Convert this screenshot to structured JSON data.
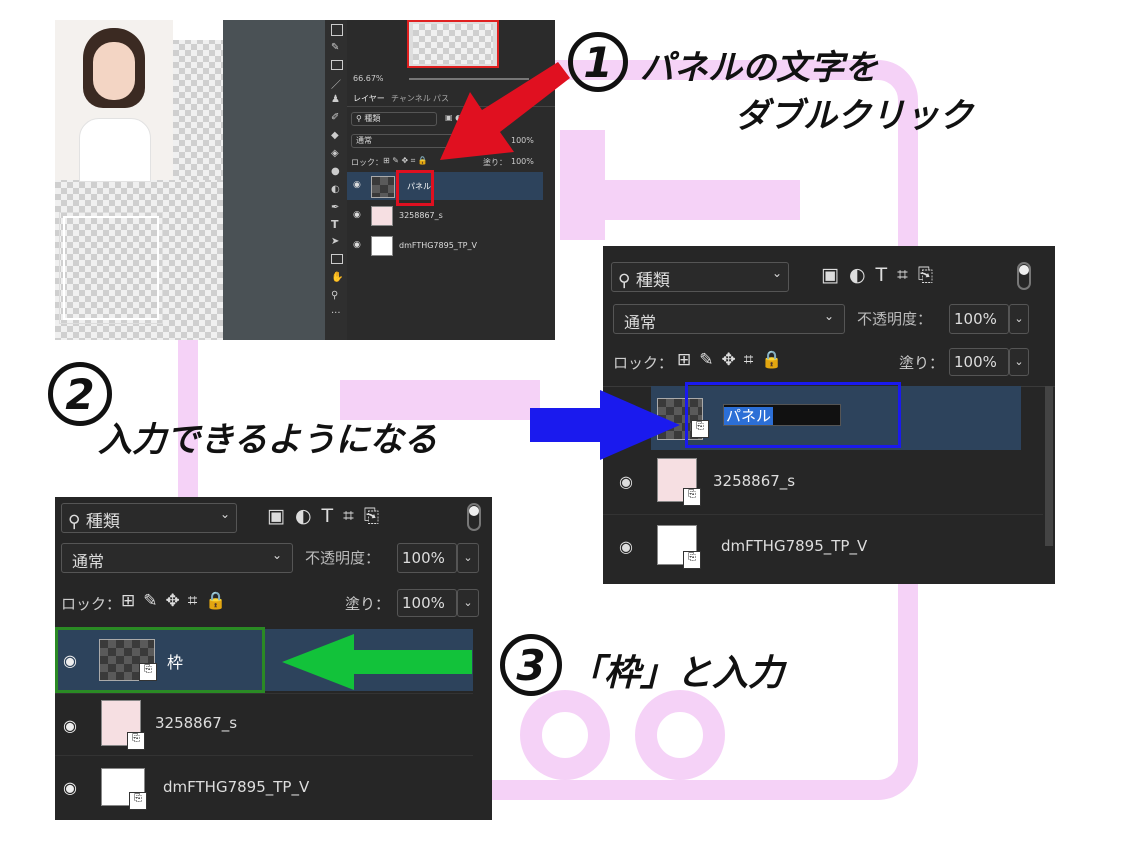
{
  "colors": {
    "accent_red": "#e01020",
    "accent_blue": "#1a1aee",
    "accent_green": "#12c23a",
    "pink_watermark": "#f5d2f7",
    "panel_bg": "#262626",
    "selected_row": "#2d435c"
  },
  "step1": {
    "number": "1",
    "line1": "パネルの文字を",
    "line2": "ダブルクリック"
  },
  "step2": {
    "number": "2",
    "text": "入力できるようになる"
  },
  "step3": {
    "number": "3",
    "text": "「枠」と入力"
  },
  "shot1": {
    "zoom": "66.67%",
    "tabs": [
      "レイヤー",
      "チャンネル",
      "パス"
    ],
    "kind_label": "種類",
    "blend_mode": "通常",
    "opacity_value": "100%",
    "lock_label": "ロック：",
    "fill_label": "塗り：",
    "fill_value": "100%",
    "layers": [
      {
        "name": "パネル"
      },
      {
        "name": "3258867_s"
      },
      {
        "name": "dmFTHG7895_TP_V"
      }
    ]
  },
  "shot2": {
    "kind_label": "種類",
    "blend_mode": "通常",
    "opacity_label": "不透明度：",
    "opacity_value": "100%",
    "lock_label": "ロック：",
    "fill_label": "塗り：",
    "fill_value": "100%",
    "layers": [
      {
        "name": "パネル"
      },
      {
        "name": "3258867_s"
      },
      {
        "name": "dmFTHG7895_TP_V"
      }
    ]
  },
  "shot3": {
    "kind_label": "種類",
    "blend_mode": "通常",
    "opacity_label": "不透明度：",
    "opacity_value": "100%",
    "lock_label": "ロック：",
    "fill_label": "塗り：",
    "fill_value": "100%",
    "layers": [
      {
        "name": "枠"
      },
      {
        "name": "3258867_s"
      },
      {
        "name": "dmFTHG7895_TP_V"
      }
    ]
  },
  "icons": [
    "search-icon",
    "image-filter-icon",
    "adjustment-filter-icon",
    "type-filter-icon",
    "shape-filter-icon",
    "smart-object-filter-icon",
    "toggle-filter-icon",
    "eye-icon",
    "lock-icon",
    "move-icon",
    "brush-icon"
  ]
}
